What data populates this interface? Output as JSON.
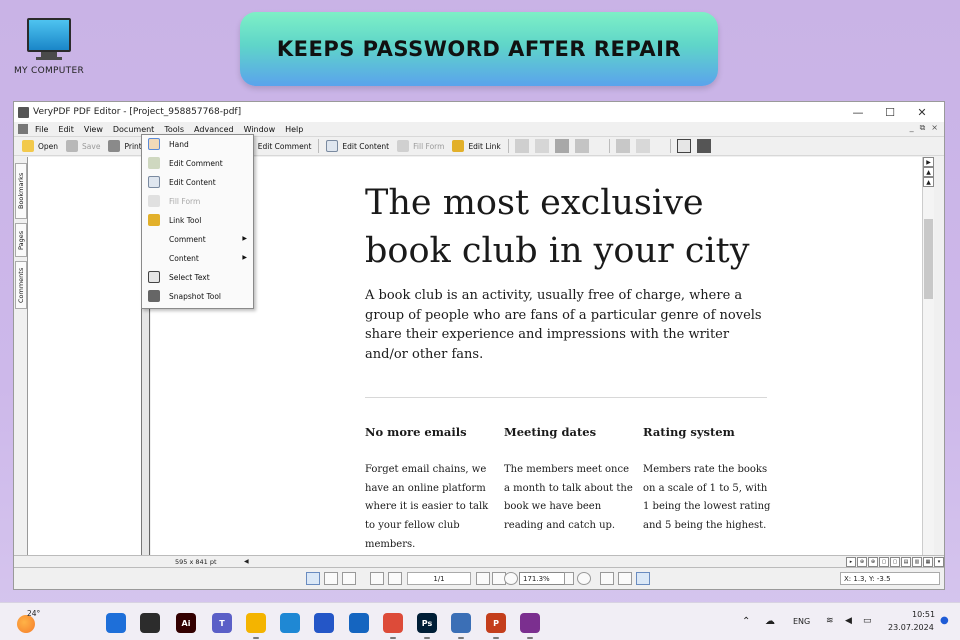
{
  "desktop": {
    "icon_label": "MY COMPUTER",
    "banner": "KEEPS PASSWORD AFTER REPAIR"
  },
  "window": {
    "title": "VeryPDF PDF Editor - [Project_958857768-pdf]",
    "controls": [
      "—",
      "☐",
      "✕"
    ],
    "menu": [
      "File",
      "Edit",
      "View",
      "Document",
      "Tools",
      "Advanced",
      "Window",
      "Help"
    ],
    "mdi_controls": [
      "_",
      "⧉",
      "×"
    ],
    "toolbar": {
      "open": "Open",
      "save": "Save",
      "print": "Print",
      "edit_comment": "Edit Comment",
      "edit_content": "Edit Content",
      "fill_form": "Fill Form",
      "edit_link": "Edit Link"
    },
    "left_tabs": [
      "Bookmarks",
      "Pages",
      "Comments"
    ],
    "tools_menu": [
      {
        "label": "Hand",
        "icon": "hand-icon",
        "disabled": false,
        "submenu": false
      },
      {
        "label": "Edit Comment",
        "icon": "edit-comment-icon",
        "disabled": false,
        "submenu": false
      },
      {
        "label": "Edit Content",
        "icon": "edit-content-icon",
        "disabled": false,
        "submenu": false
      },
      {
        "label": "Fill Form",
        "icon": "fill-form-icon",
        "disabled": true,
        "submenu": false
      },
      {
        "label": "Link Tool",
        "icon": "link-tool-icon",
        "disabled": false,
        "submenu": false
      },
      {
        "label": "Comment",
        "icon": "",
        "disabled": false,
        "submenu": true
      },
      {
        "label": "Content",
        "icon": "",
        "disabled": false,
        "submenu": true
      },
      {
        "label": "Select Text",
        "icon": "select-text-icon",
        "disabled": false,
        "submenu": false
      },
      {
        "label": "Snapshot Tool",
        "icon": "snapshot-icon",
        "disabled": false,
        "submenu": false
      }
    ],
    "status": {
      "page_size": "595 x 841 pt",
      "page_indicator": "1/1",
      "zoom": "171.3%",
      "coords": "X: 1.3, Y: -3.5"
    }
  },
  "document": {
    "heading": "The most exclusive book club in your city",
    "lead": "A book club is an activity, usually free of charge, where a group of people who are fans of a particular genre of novels share their experience and impressions with the writer and/or other fans.",
    "columns": [
      {
        "title": "No more emails",
        "body": "Forget email chains, we have an online platform where it is easier to talk to your fellow club members."
      },
      {
        "title": "Meeting dates",
        "body": "The members meet once a month to talk about the book we have been reading and catch up."
      },
      {
        "title": "Rating system",
        "body": "Members rate the books on a scale of 1 to 5, with 1 being the lowest rating and 5 being the highest."
      }
    ]
  },
  "taskbar": {
    "temperature": "24°",
    "language": "ENG",
    "time": "10:51",
    "date": "23.07.2024",
    "apps": [
      {
        "name": "windows-start-icon",
        "label": "",
        "color": "#1e6fd9"
      },
      {
        "name": "task-view-icon",
        "label": "",
        "color": "#2c2c2c"
      },
      {
        "name": "illustrator-icon",
        "label": "Ai",
        "color": "#330000"
      },
      {
        "name": "teams-icon",
        "label": "T",
        "color": "#5b5fc7"
      },
      {
        "name": "file-explorer-icon",
        "label": "",
        "color": "#f4b400"
      },
      {
        "name": "edge-icon",
        "label": "",
        "color": "#1f88d4"
      },
      {
        "name": "store-icon",
        "label": "",
        "color": "#2456c7"
      },
      {
        "name": "mail-icon",
        "label": "",
        "color": "#1565c0"
      },
      {
        "name": "chrome-icon",
        "label": "",
        "color": "#dd4b39"
      },
      {
        "name": "photoshop-icon",
        "label": "Ps",
        "color": "#001e36"
      },
      {
        "name": "pdf-tool-icon",
        "label": "",
        "color": "#3b6fb6"
      },
      {
        "name": "powerpoint-icon",
        "label": "P",
        "color": "#c43e1c"
      },
      {
        "name": "archive-icon",
        "label": "",
        "color": "#7b2f8f"
      }
    ]
  }
}
